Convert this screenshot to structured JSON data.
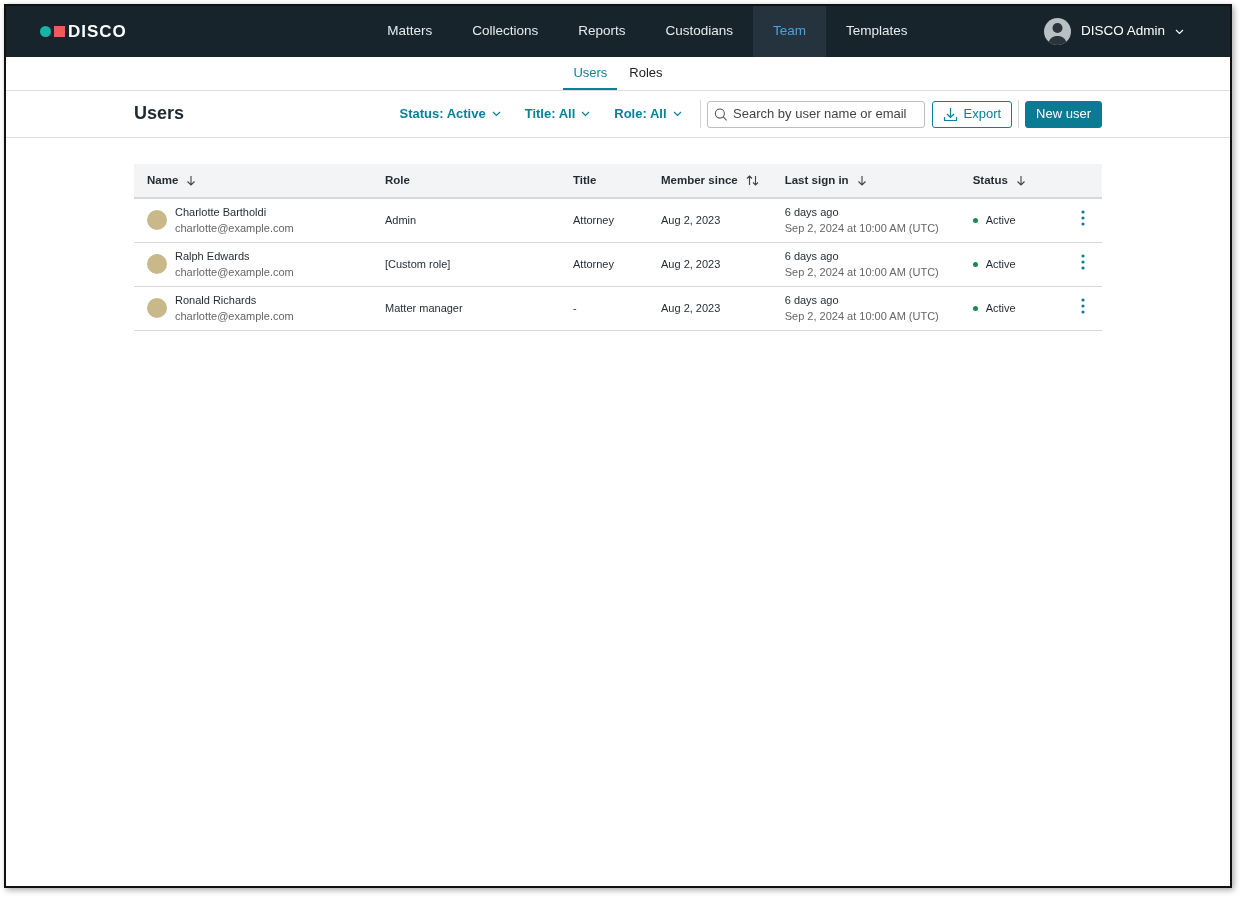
{
  "brand": "DISCO",
  "nav": [
    {
      "label": "Matters",
      "selected": false
    },
    {
      "label": "Collections",
      "selected": false
    },
    {
      "label": "Reports",
      "selected": false
    },
    {
      "label": "Custodians",
      "selected": false
    },
    {
      "label": "Team",
      "selected": true
    },
    {
      "label": "Templates",
      "selected": false
    }
  ],
  "user_menu": {
    "label": "DISCO Admin"
  },
  "subtabs": [
    {
      "label": "Users",
      "selected": true
    },
    {
      "label": "Roles",
      "selected": false
    }
  ],
  "page_title": "Users",
  "filters": [
    "Status: Active",
    "Title: All",
    "Role: All"
  ],
  "search": {
    "placeholder": "Search by user name or email"
  },
  "buttons": [
    {
      "label": "Export",
      "kind": "outline"
    },
    {
      "label": "New user",
      "kind": "primary"
    }
  ],
  "table": {
    "columns": [
      {
        "label": "Name",
        "kind": "down"
      },
      {
        "label": "Role",
        "kind": "plain"
      },
      {
        "label": "Title",
        "kind": "plain"
      },
      {
        "label": "Member since",
        "kind": "both"
      },
      {
        "label": "Last sign in",
        "kind": "down"
      },
      {
        "label": "Status",
        "kind": "down"
      }
    ],
    "rows": [
      {
        "name": "Charlotte Bartholdi",
        "email": "charlotte@example.com",
        "role": "Admin",
        "title": "Attorney",
        "member_since": "Aug 2, 2023",
        "last_sign_in": "6 days ago",
        "last_sign_in_detail": "Sep 2, 2024 at 10:00 AM (UTC)",
        "status": "Active"
      },
      {
        "name": "Ralph Edwards",
        "email": "charlotte@example.com",
        "role": "[Custom role]",
        "title": "Attorney",
        "member_since": "Aug 2, 2023",
        "last_sign_in": "6 days ago",
        "last_sign_in_detail": "Sep 2, 2024 at 10:00 AM (UTC)",
        "status": "Active"
      },
      {
        "name": "Ronald Richards",
        "email": "charlotte@example.com",
        "role": "Matter manager",
        "title": "-",
        "member_since": "Aug 2, 2023",
        "last_sign_in": "6 days ago",
        "last_sign_in_detail": "Sep 2, 2024 at 10:00 AM (UTC)",
        "status": "Active"
      }
    ]
  }
}
